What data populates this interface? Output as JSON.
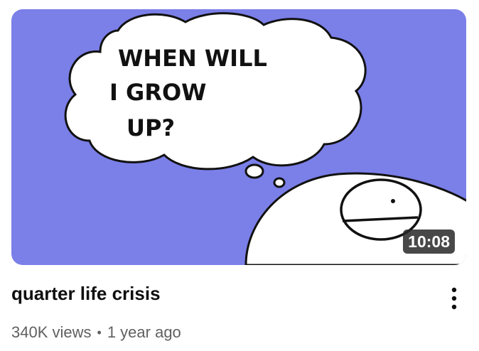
{
  "video": {
    "title": "quarter life crisis",
    "views": "340K views",
    "separator": "•",
    "age": "1 year ago",
    "duration": "10:08"
  },
  "thumbnail": {
    "bubble_text": {
      "line1": "WHEN WILL",
      "line2": "I GROW",
      "line3": "UP?"
    },
    "background_color": "#7b7fe8"
  },
  "icons": {
    "more": "more-vert-icon"
  }
}
